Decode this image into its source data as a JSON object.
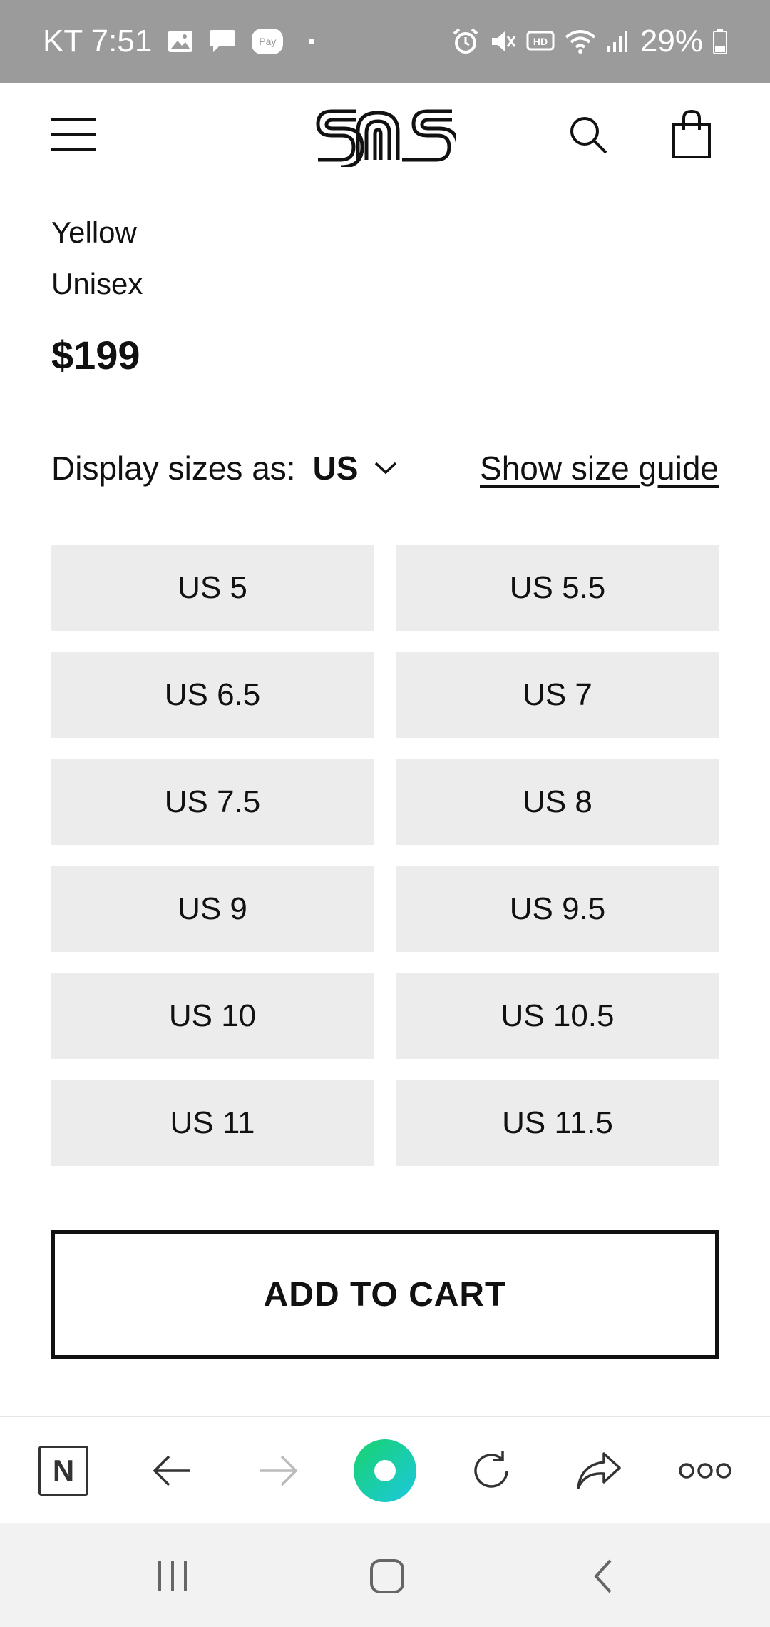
{
  "status_bar": {
    "carrier_time": "KT 7:51",
    "pay_label": "Pay",
    "battery": "29%"
  },
  "header": {
    "logo_text": "SNS"
  },
  "product": {
    "color": "Yellow",
    "gender": "Unisex",
    "price": "$199"
  },
  "sizes": {
    "display_label": "Display sizes as:",
    "system": "US",
    "size_guide": "Show size guide",
    "options": [
      "US 5",
      "US 5.5",
      "US 6.5",
      "US 7",
      "US 7.5",
      "US 8",
      "US 9",
      "US 9.5",
      "US 10",
      "US 10.5",
      "US 11",
      "US 11.5"
    ]
  },
  "actions": {
    "add_to_cart": "ADD TO CART"
  },
  "browser": {
    "n_label": "N",
    "accent_color": "#1fd3a0"
  }
}
